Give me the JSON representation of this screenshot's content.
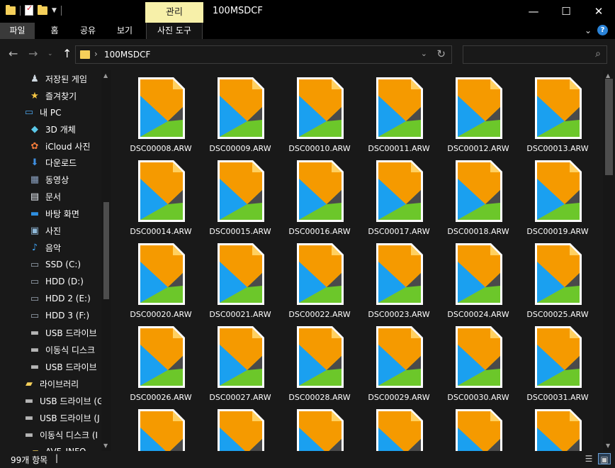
{
  "window": {
    "title": "100MSDCF",
    "manage_tab": "관리",
    "minimize": "—",
    "maximize": "☐",
    "close": "✕"
  },
  "ribbon": {
    "file": "파일",
    "home": "홈",
    "share": "공유",
    "view": "보기",
    "picture_tools": "사진 도구",
    "expand_icon": "⌄",
    "help": "?"
  },
  "address": {
    "back": "←",
    "forward": "→",
    "recent": "⌄",
    "up": "↑",
    "separator": "›",
    "path": "100MSDCF",
    "history": "⌄",
    "refresh": "↻"
  },
  "search": {
    "placeholder": "",
    "icon": "⌕"
  },
  "sidebar": {
    "items": [
      {
        "label": "저장된 게임",
        "icon": "♟",
        "color": "#cfd8e0",
        "indent": 40
      },
      {
        "label": "즐겨찾기",
        "icon": "★",
        "color": "#f5c542",
        "indent": 40
      },
      {
        "label": "내 PC",
        "icon": "▭",
        "color": "#4aa3e8",
        "indent": 32
      },
      {
        "label": "3D 개체",
        "icon": "◆",
        "color": "#5bc8e8",
        "indent": 40
      },
      {
        "label": "iCloud 사진",
        "icon": "✿",
        "color": "#f07a3a",
        "indent": 40
      },
      {
        "label": "다운로드",
        "icon": "⬇",
        "color": "#3f8fe0",
        "indent": 40
      },
      {
        "label": "동영상",
        "icon": "▦",
        "color": "#8aa0c0",
        "indent": 40
      },
      {
        "label": "문서",
        "icon": "▤",
        "color": "#e8eef5",
        "indent": 40
      },
      {
        "label": "바탕 화면",
        "icon": "▬",
        "color": "#2f8fe0",
        "indent": 40
      },
      {
        "label": "사진",
        "icon": "▣",
        "color": "#8fb8d8",
        "indent": 40
      },
      {
        "label": "음악",
        "icon": "♪",
        "color": "#3fa0f0",
        "indent": 40
      },
      {
        "label": "SSD (C:)",
        "icon": "▭",
        "color": "#9aa6b2",
        "indent": 40
      },
      {
        "label": "HDD (D:)",
        "icon": "▭",
        "color": "#9aa6b2",
        "indent": 40
      },
      {
        "label": "HDD 2 (E:)",
        "icon": "▭",
        "color": "#9aa6b2",
        "indent": 40
      },
      {
        "label": "HDD 3 (F:)",
        "icon": "▭",
        "color": "#9aa6b2",
        "indent": 40
      },
      {
        "label": "USB 드라이브",
        "icon": "▬",
        "color": "#b5b5b5",
        "indent": 40
      },
      {
        "label": "이동식 디스크",
        "icon": "▬",
        "color": "#b5b5b5",
        "indent": 40
      },
      {
        "label": "USB 드라이브",
        "icon": "▬",
        "color": "#b5b5b5",
        "indent": 40
      },
      {
        "label": "라이브러리",
        "icon": "▰",
        "color": "#f5cf5a",
        "indent": 32
      },
      {
        "label": "USB 드라이브 (G",
        "icon": "▬",
        "color": "#b5b5b5",
        "indent": 32
      },
      {
        "label": "USB 드라이브 (J",
        "icon": "▬",
        "color": "#b5b5b5",
        "indent": 32
      },
      {
        "label": "이동식 디스크 (I",
        "icon": "▬",
        "color": "#b5b5b5",
        "indent": 32
      },
      {
        "label": "AVF_INFO",
        "icon": "▰",
        "color": "#f5cf5a",
        "indent": 40
      }
    ]
  },
  "files": [
    "DSC00008.ARW",
    "DSC00009.ARW",
    "DSC00010.ARW",
    "DSC00011.ARW",
    "DSC00012.ARW",
    "DSC00013.ARW",
    "DSC00014.ARW",
    "DSC00015.ARW",
    "DSC00016.ARW",
    "DSC00017.ARW",
    "DSC00018.ARW",
    "DSC00019.ARW",
    "DSC00020.ARW",
    "DSC00021.ARW",
    "DSC00022.ARW",
    "DSC00023.ARW",
    "DSC00024.ARW",
    "DSC00025.ARW",
    "DSC00026.ARW",
    "DSC00027.ARW",
    "DSC00028.ARW",
    "DSC00029.ARW",
    "DSC00030.ARW",
    "DSC00031.ARW",
    "",
    "",
    "",
    "",
    "",
    ""
  ],
  "status": {
    "count": "99개 항목",
    "cursor": "|",
    "details_view": "☰",
    "tiles_view": "▣"
  },
  "colors": {
    "accent": "#f7f0a9",
    "file_orange": "#f59a00",
    "file_blue": "#1aa0f0",
    "file_green": "#6cc72a"
  }
}
